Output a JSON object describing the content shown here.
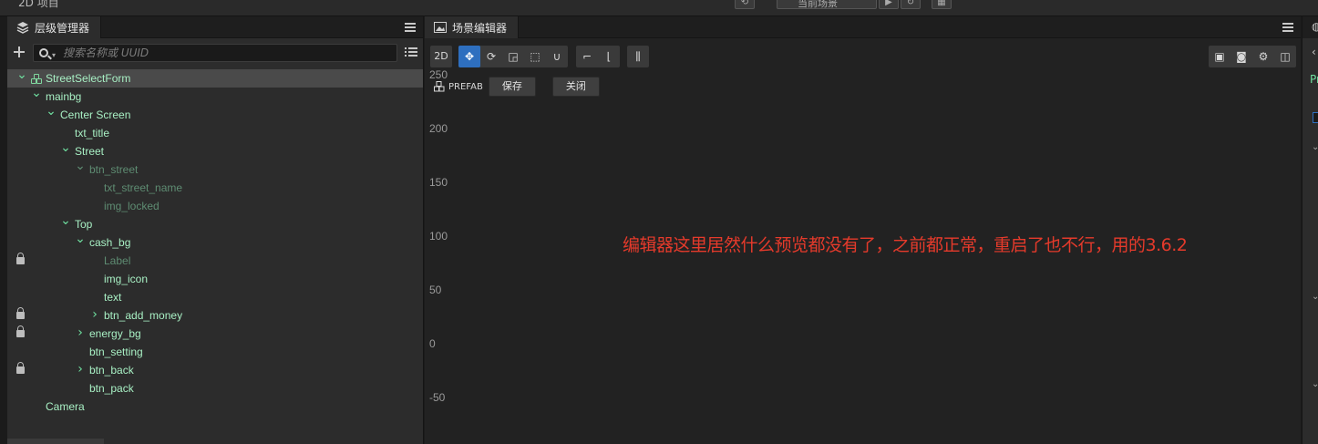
{
  "topbar": {
    "app_title": "2D 项目",
    "scene_select": "当前场景",
    "play_glyph": "▶",
    "refresh_glyph": "↻"
  },
  "hierarchy": {
    "tab_label": "层级管理器",
    "search_placeholder": "搜索名称或 UUID",
    "tree": [
      {
        "label": "StreetSelectForm",
        "depth": 0,
        "expanded": true,
        "prefab": true,
        "selected": true
      },
      {
        "label": "mainbg",
        "depth": 1,
        "expanded": true
      },
      {
        "label": "Center Screen",
        "depth": 2,
        "expanded": true
      },
      {
        "label": "txt_title",
        "depth": 3
      },
      {
        "label": "Street",
        "depth": 3,
        "expanded": true
      },
      {
        "label": "btn_street",
        "depth": 4,
        "expanded": true,
        "dim": true
      },
      {
        "label": "txt_street_name",
        "depth": 5,
        "dim": true
      },
      {
        "label": "img_locked",
        "depth": 5,
        "dim": true
      },
      {
        "label": "Top",
        "depth": 3,
        "expanded": true
      },
      {
        "label": "cash_bg",
        "depth": 4,
        "expanded": true
      },
      {
        "label": "Label",
        "depth": 5,
        "dim": true,
        "locked": true
      },
      {
        "label": "img_icon",
        "depth": 5
      },
      {
        "label": "text",
        "depth": 5
      },
      {
        "label": "btn_add_money",
        "depth": 5,
        "collapsed": true,
        "locked": true
      },
      {
        "label": "energy_bg",
        "depth": 4,
        "collapsed": true,
        "locked": true
      },
      {
        "label": "btn_setting",
        "depth": 4
      },
      {
        "label": "btn_back",
        "depth": 4,
        "collapsed": true,
        "locked": true
      },
      {
        "label": "btn_pack",
        "depth": 4
      },
      {
        "label": "Camera",
        "depth": 1
      }
    ]
  },
  "scene": {
    "tab_label": "场景编辑器",
    "toolbar": {
      "mode_2d": "2D"
    },
    "prefab_bar": {
      "label": "PREFAB",
      "save_label": "保存",
      "close_label": "关闭"
    },
    "axis_ticks": [
      "250",
      "200",
      "150",
      "100",
      "50",
      "0",
      "-50"
    ],
    "annotation": "编辑器这里居然什么预览都没有了，之前都正常，重启了也不行，用的3.6.2"
  },
  "inspector": {
    "tab_label_partial": "Pr"
  },
  "colors": {
    "accent_blue": "#2e6fbf",
    "node_green": "#a8f0c4",
    "node_dim": "#5e8c72",
    "annotation_red": "#e53a2b"
  }
}
